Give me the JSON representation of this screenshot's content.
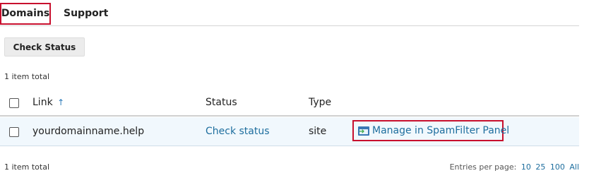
{
  "tabs": [
    {
      "label": "Domains",
      "active": true
    },
    {
      "label": "Support",
      "active": false
    }
  ],
  "toolbar": {
    "check_status_label": "Check Status"
  },
  "summary": {
    "items_total_top": "1 item total",
    "items_total_bottom": "1 item total"
  },
  "table": {
    "columns": {
      "link": "Link",
      "status": "Status",
      "type": "Type"
    },
    "sort_indicator": "↑",
    "rows": [
      {
        "domain": "yourdomainname.help",
        "status": "Check status",
        "type": "site",
        "action": "Manage in SpamFilter Panel"
      }
    ]
  },
  "pagination": {
    "label": "Entries per page:",
    "options": [
      "10",
      "25",
      "100",
      "All"
    ]
  },
  "colors": {
    "link": "#1e6e9e",
    "highlight": "#c8102e",
    "row_bg": "#f1f8fd"
  }
}
